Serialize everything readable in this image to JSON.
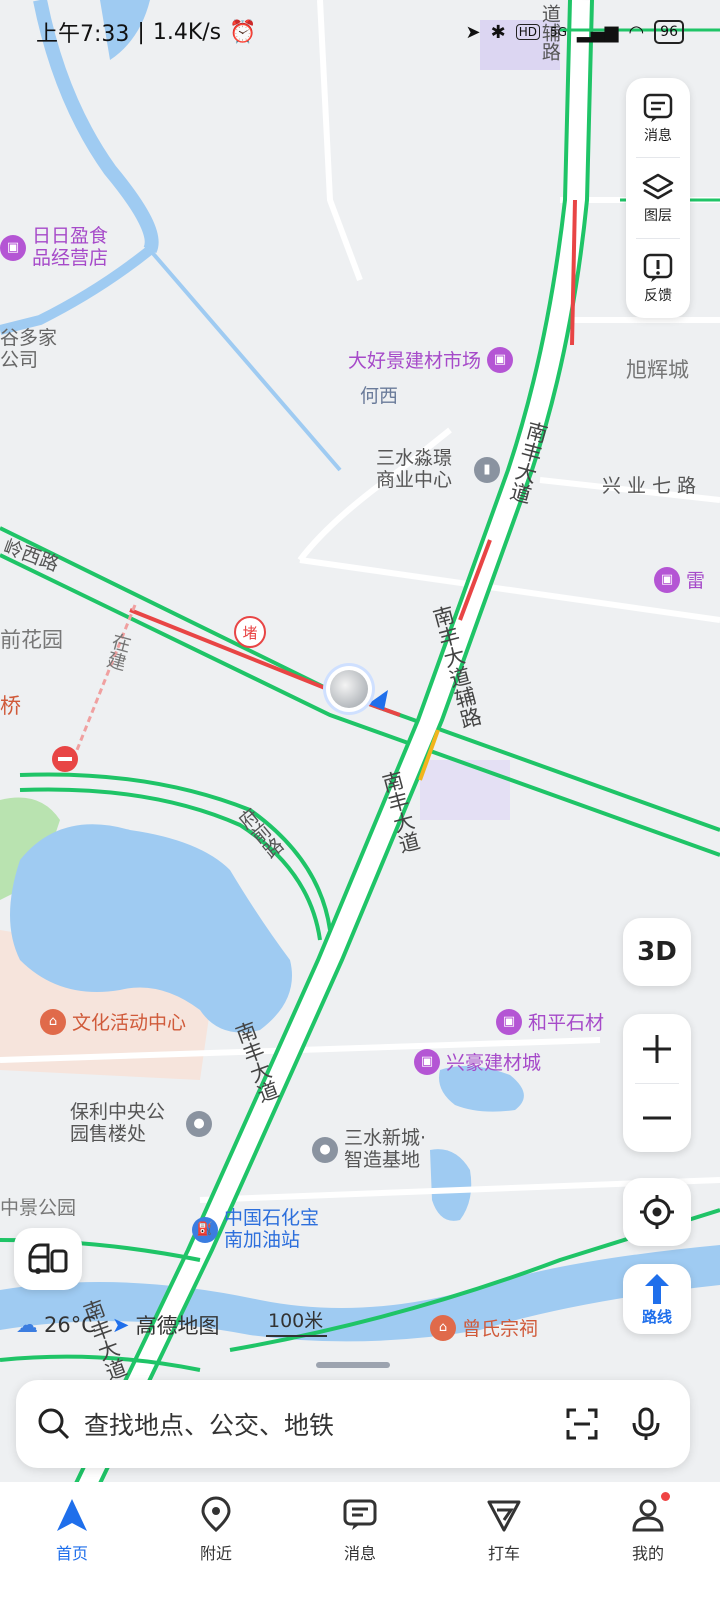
{
  "status_bar": {
    "time": "上午7:33",
    "net_speed": "1.4K/s",
    "signal": "5G",
    "hd": "HD",
    "battery": "96"
  },
  "map": {
    "road_labels": {
      "nanfeng_1": "南丰大道",
      "nanfeng_2": "南丰大道",
      "nanfeng_3": "南丰大道",
      "nanfeng_fu": "南丰大道辅路",
      "road_top": "道辅路",
      "lingxi": "岭西路",
      "fuqian": "府前路",
      "zaijian": "在建",
      "xingye": "兴业七路",
      "nanfeng_bottom": "南丰大道"
    },
    "area_labels": {
      "hexi": "何西",
      "xuhui": "旭辉城",
      "huayuan": "前花园",
      "qiao": "桥",
      "guduojia": "谷多家公司",
      "zhongjing": "中景公园",
      "lei": "雷"
    },
    "pois": {
      "ririying": "日日盈食品经营店",
      "dahaojing": "大好景建材市场",
      "sanshui_shangye": "三水淼璟商业中心",
      "wenhua": "文化活动中心",
      "heping": "和平石材",
      "xinghao": "兴豪建材城",
      "baoli": "保利中央公园售楼处",
      "sanshui_xincheng": "三水新城·智造基地",
      "zhongshihua": "中国石化宝南加油站",
      "zengshi": "曾氏宗祠"
    },
    "traffic_badge": "堵"
  },
  "tools": {
    "messages": "消息",
    "layers": "图层",
    "feedback": "反馈"
  },
  "controls": {
    "three_d": "3D",
    "route": "路线"
  },
  "overlay": {
    "temperature": "26°C",
    "brand": "高德地图",
    "scale": "100米"
  },
  "search": {
    "placeholder": "查找地点、公交、地铁"
  },
  "tabs": {
    "home": "首页",
    "nearby": "附近",
    "messages": "消息",
    "taxi": "打车",
    "mine": "我的"
  },
  "colors": {
    "accent": "#1f6feb",
    "road_green": "#1fc467",
    "road_red": "#e84545",
    "road_yellow": "#f2b51c",
    "water": "#9fcbf2",
    "poi_purple": "#b455d4"
  }
}
